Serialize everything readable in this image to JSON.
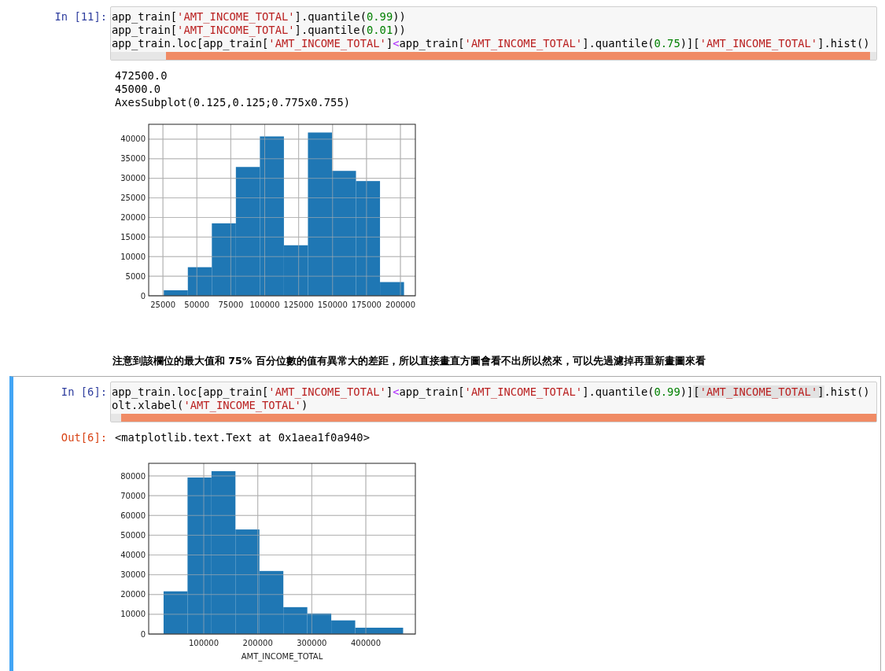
{
  "cells": [
    {
      "kind": "code",
      "prompt": "In [11]:",
      "selected": false,
      "lines": [
        [
          {
            "text": "app_train[",
            "kind": "plain"
          },
          {
            "text": "'AMT_INCOME_TOTAL'",
            "kind": "string"
          },
          {
            "text": "].quantile(",
            "kind": "plain"
          },
          {
            "text": "0.99",
            "kind": "number"
          },
          {
            "text": "))",
            "kind": "plain"
          }
        ],
        [
          {
            "text": "app_train[",
            "kind": "plain"
          },
          {
            "text": "'AMT_INCOME_TOTAL'",
            "kind": "string"
          },
          {
            "text": "].quantile(",
            "kind": "plain"
          },
          {
            "text": "0.01",
            "kind": "number"
          },
          {
            "text": "))",
            "kind": "plain"
          }
        ],
        [
          {
            "text": "app_train.loc[app_train[",
            "kind": "plain"
          },
          {
            "text": "'AMT_INCOME_TOTAL'",
            "kind": "string"
          },
          {
            "text": "]",
            "kind": "plain"
          },
          {
            "text": "<",
            "kind": "operator"
          },
          {
            "text": "app_train[",
            "kind": "plain"
          },
          {
            "text": "'AMT_INCOME_TOTAL'",
            "kind": "string"
          },
          {
            "text": "].quantile(",
            "kind": "plain"
          },
          {
            "text": "0.75",
            "kind": "number"
          },
          {
            "text": ")][",
            "kind": "plain"
          },
          {
            "text": "'AMT_INCOME_TOTAL'",
            "kind": "string"
          },
          {
            "text": "].hist()",
            "kind": "plain"
          }
        ]
      ],
      "outputs": [
        {
          "kind": "text",
          "lines": [
            "472500.0",
            "45000.0",
            "AxesSubplot(0.125,0.125;0.775x0.755)"
          ]
        },
        {
          "kind": "chart",
          "chart_data": {
            "type": "bar",
            "grid": true,
            "x": [
              34500,
              52200,
              69900,
              87600,
              105300,
              123000,
              140700,
              158400,
              176100,
              193800
            ],
            "values": [
              1400,
              7300,
              18500,
              32900,
              40700,
              12900,
              41700,
              31900,
              29300,
              3500
            ],
            "xlim": [
              14500,
              211000
            ],
            "ylim": [
              0,
              43800
            ],
            "xticks": [
              25000,
              50000,
              75000,
              100000,
              125000,
              150000,
              175000,
              200000
            ],
            "yticks": [
              0,
              5000,
              10000,
              15000,
              20000,
              25000,
              30000,
              35000,
              40000
            ]
          }
        }
      ]
    },
    {
      "kind": "markdown",
      "text": "注意到該欄位的最大值和 75% 百分位數的值有異常大的差距，所以直接畫直方圖會看不出所以然來，可以先過濾掉再重新畫圖來看"
    },
    {
      "kind": "code",
      "prompt": "In [6]:",
      "selected": true,
      "lines": [
        [
          {
            "text": "app_train.loc[app_train[",
            "kind": "plain"
          },
          {
            "text": "'AMT_INCOME_TOTAL'",
            "kind": "string"
          },
          {
            "text": "]",
            "kind": "plain"
          },
          {
            "text": "<",
            "kind": "operator"
          },
          {
            "text": "app_train[",
            "kind": "plain"
          },
          {
            "text": "'AMT_INCOME_TOTAL'",
            "kind": "string"
          },
          {
            "text": "].quantile(",
            "kind": "plain"
          },
          {
            "text": "0.99",
            "kind": "number"
          },
          {
            "text": ")]",
            "kind": "plain"
          },
          {
            "text": "[",
            "kind": "match"
          },
          {
            "text": "'AMT_INCOME_TOTAL'",
            "kind": "matchstring"
          },
          {
            "text": "]",
            "kind": "match"
          },
          {
            "text": ".hist()",
            "kind": "plain"
          }
        ],
        [
          {
            "text": "olt.xlabel(",
            "kind": "plain"
          },
          {
            "text": "'AMT_INCOME_TOTAL'",
            "kind": "string"
          },
          {
            "text": ")",
            "kind": "plain"
          }
        ]
      ],
      "outputs": [
        {
          "kind": "result",
          "prompt": "Out[6]:",
          "text": "<matplotlib.text.Text at 0x1aea1f0a940>"
        },
        {
          "kind": "chart",
          "chart_data": {
            "type": "bar",
            "xlabel": "AMT_INCOME_TOTAL",
            "grid": true,
            "x": [
              47820,
              92160,
              136500,
              180840,
              225180,
              269520,
              313860,
              358200,
              402540,
              446880
            ],
            "values": [
              21600,
              79200,
              82400,
              52900,
              31900,
              13600,
              10400,
              6900,
              3200,
              3200
            ],
            "xlim": [
              -1940,
              491700
            ],
            "ylim": [
              0,
              86370
            ],
            "xticks": [
              100000,
              200000,
              300000,
              400000
            ],
            "yticks": [
              0,
              10000,
              20000,
              30000,
              40000,
              50000,
              60000,
              70000,
              80000
            ]
          }
        }
      ]
    }
  ]
}
